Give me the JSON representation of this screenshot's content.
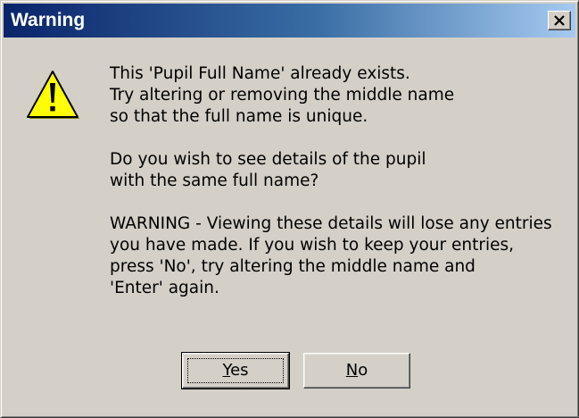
{
  "window": {
    "title": "Warning",
    "close_icon": "close-x-icon"
  },
  "icon": {
    "name": "warning-triangle-icon",
    "color": "#ffff00"
  },
  "message": {
    "paragraph1": "This 'Pupil Full Name' already exists.\nTry altering or removing the middle name\nso that the full name is unique.",
    "paragraph2": "Do you wish to see details of the pupil\nwith the same full name?",
    "paragraph3": "WARNING - Viewing these details will lose any entries\nyou have made. If you wish to keep your entries,\npress 'No', try altering the middle name and\n'Enter' again."
  },
  "buttons": {
    "yes": {
      "accel": "Y",
      "rest": "es"
    },
    "no": {
      "accel": "N",
      "rest": "o"
    }
  }
}
